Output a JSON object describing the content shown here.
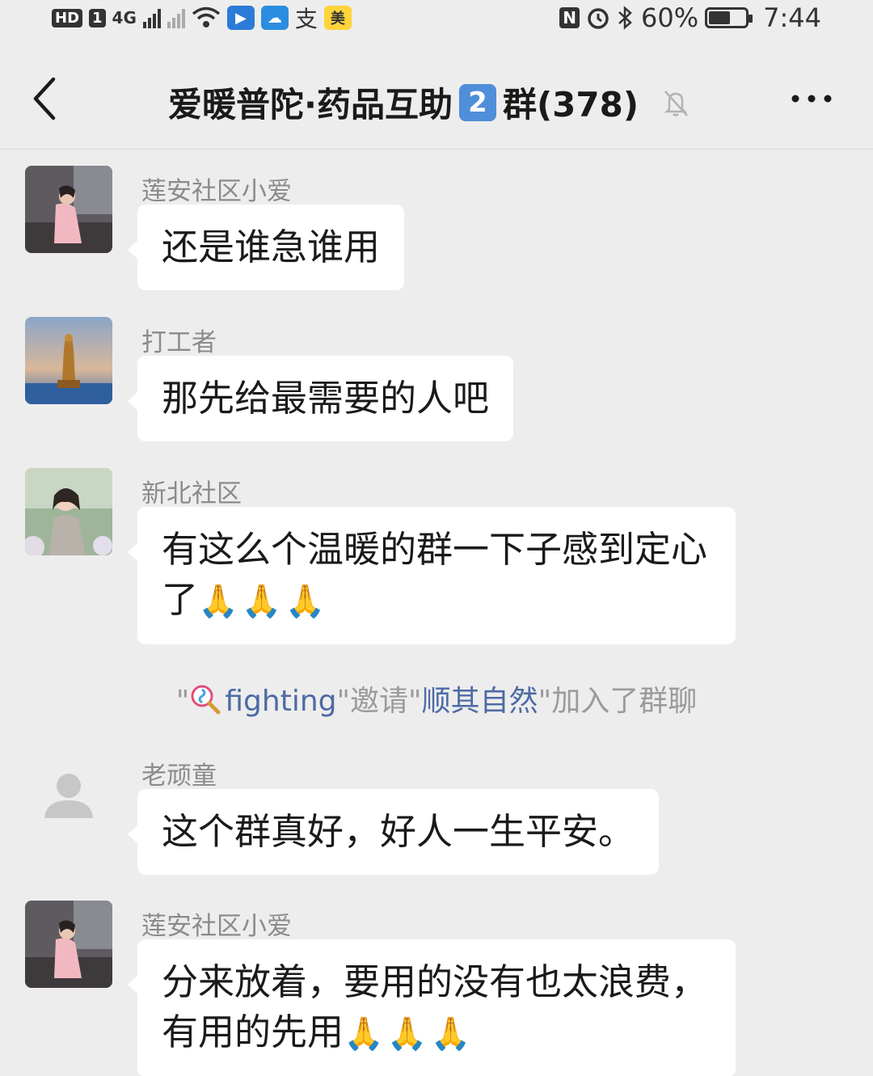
{
  "status_bar": {
    "hd": "HD",
    "sim": "1",
    "net": "4G",
    "app_icon_1": "支",
    "app_icon_2": "美",
    "battery_text": "60%",
    "battery_level": 0.6,
    "time": "7:44"
  },
  "header": {
    "title_part1": "爱暖普陀·药品互助",
    "title_badge": "2",
    "title_part2": "群(378)",
    "back_icon": "chevron-left-icon",
    "mute_icon": "bell-off-icon",
    "more_icon": "more-horizontal-icon"
  },
  "messages": [
    {
      "sender": "莲安社区小爱",
      "text": "还是谁急谁用",
      "pray": ""
    },
    {
      "sender": "打工者",
      "text": "那先给最需要的人吧",
      "pray": ""
    },
    {
      "sender": "新北社区",
      "text": "有这么个温暖的群一下子感到定心了",
      "pray": "🙏🙏🙏"
    },
    {
      "sender": "老顽童",
      "text": "这个群真好，好人一生平安。",
      "pray": ""
    },
    {
      "sender": "莲安社区小爱",
      "text": "分来放着，要用的没有也太浪费，有用的先用",
      "pray": "🙏🙏🙏"
    }
  ],
  "system_message": {
    "quote_open": "\"",
    "inviter": "fighting",
    "mid": "\"邀请\"",
    "invitee": "顺其自然",
    "tail": "\"加入了群聊"
  },
  "colors": {
    "background": "#ededed",
    "bubble": "#ffffff",
    "sender_text": "#8b8b8b",
    "system_link": "#4d6aa5"
  }
}
